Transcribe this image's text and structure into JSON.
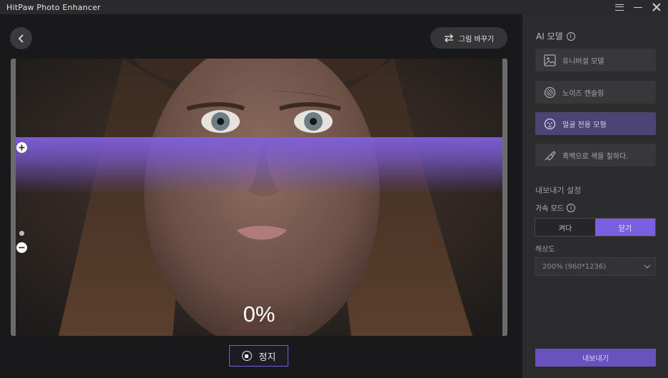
{
  "app": {
    "title": "HitPaw Photo Enhancer"
  },
  "toolbar": {
    "replace_label": "그림 바꾸기"
  },
  "preview": {
    "progress_text": "0%",
    "progress_value": 0
  },
  "stop": {
    "label": "정지"
  },
  "panel": {
    "ai_model_title": "AI 모델",
    "models": [
      {
        "label": "유니버설 모델",
        "icon": "image-icon",
        "active": false
      },
      {
        "label": "노이즈 캔슬링",
        "icon": "noise-icon",
        "active": false
      },
      {
        "label": "얼굴 전용 모형",
        "icon": "face-icon",
        "active": true
      },
      {
        "label": "흑백으로 색을 칠하다.",
        "icon": "brush-icon",
        "active": false
      }
    ],
    "export_settings_title": "내보내기 설정",
    "accel_label": "가속 모드",
    "accel_options": [
      {
        "label": "켜다",
        "on": false
      },
      {
        "label": "닫기",
        "on": true
      }
    ],
    "resolution_label": "해상도",
    "resolution_value": "200% (960*1236)",
    "export_label": "내보내기"
  },
  "colors": {
    "accent": "#7a5fe0",
    "active_model_bg": "#4c4573",
    "export_bg": "#6a52be"
  }
}
